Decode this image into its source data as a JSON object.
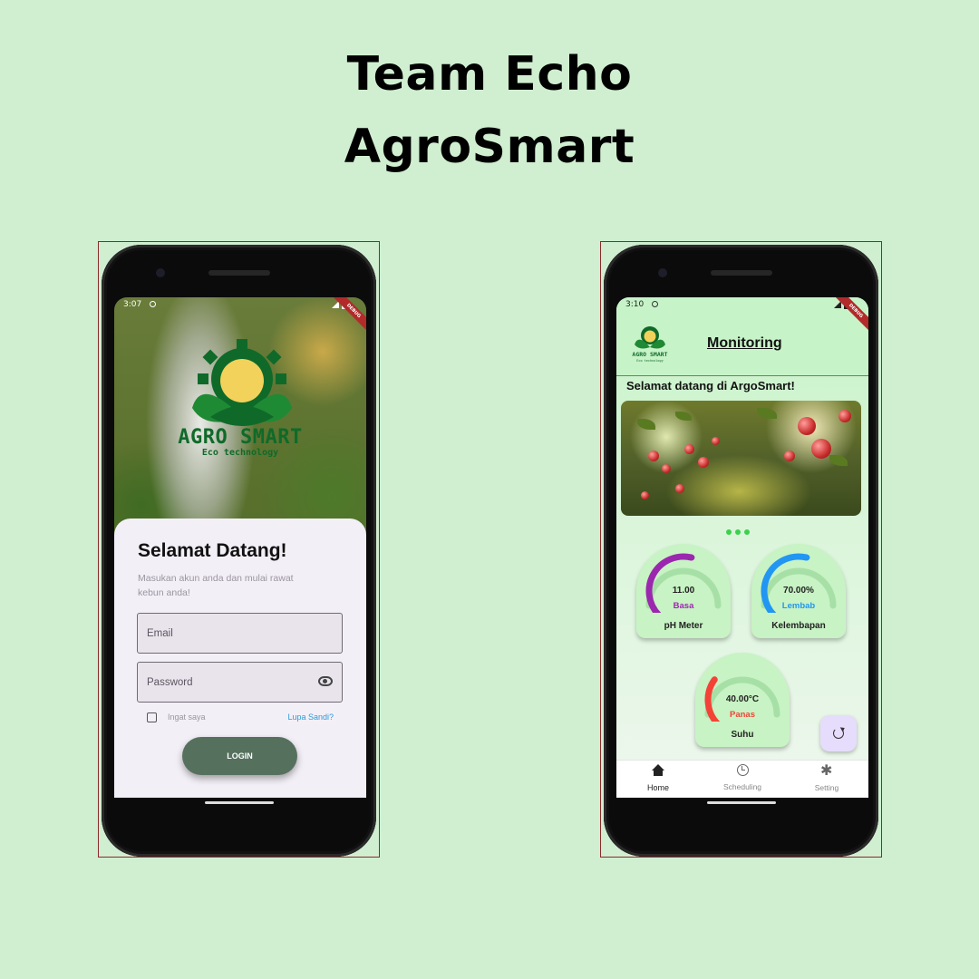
{
  "header": {
    "line1": "Team Echo",
    "line2": "AgroSmart"
  },
  "login_screen": {
    "status_time": "3:07",
    "debug_label": "DEBUG",
    "logo_title": "AGRO SMART",
    "logo_subtitle": "Eco technology",
    "card_title": "Selamat Datang!",
    "card_subtitle": "Masukan akun anda dan mulai rawat kebun anda!",
    "email_placeholder": "Email",
    "password_placeholder": "Password",
    "remember_label": "Ingat saya",
    "forgot_label": "Lupa Sandi?",
    "login_button": "LOGIN",
    "colors": {
      "button": "#56705e",
      "card": "#f3eff7",
      "logo": "#0f6a2a"
    }
  },
  "monitoring_screen": {
    "status_time": "3:10",
    "debug_label": "DEBUG",
    "logo_title": "AGRO SMART",
    "logo_subtitle": "Eco technology",
    "title": "Monitoring",
    "welcome": "Selamat datang di ArgoSmart!",
    "gauges": [
      {
        "label": "pH Meter",
        "value": "11.00",
        "status": "Basa",
        "color": "#9b27af",
        "fraction": 0.55
      },
      {
        "label": "Kelembapan",
        "value": "70.00%",
        "status": "Lembab",
        "color": "#2196f3",
        "fraction": 0.55
      },
      {
        "label": "Suhu",
        "value": "40.00°C",
        "status": "Panas",
        "color": "#f44336",
        "fraction": 0.3
      }
    ],
    "nav": [
      {
        "label": "Home",
        "icon": "home-icon",
        "active": true
      },
      {
        "label": "Scheduling",
        "icon": "clock-icon",
        "active": false
      },
      {
        "label": "Setting",
        "icon": "gear-icon",
        "active": false
      }
    ],
    "fab_icon": "refresh-icon",
    "colors": {
      "appbar": "#c7f3c8",
      "dots": "#3bd14d"
    }
  }
}
